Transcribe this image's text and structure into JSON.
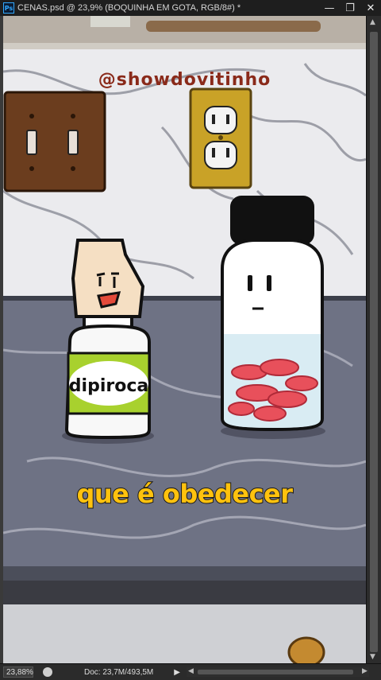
{
  "window": {
    "app_icon_label": "Ps",
    "title": "CENAS.psd @ 23,9% (BOQUINHA EM GOTA, RGB/8#) *",
    "minimize_glyph": "—",
    "restore_glyph": "❐",
    "close_glyph": "✕"
  },
  "canvas": {
    "watermark": "@showdovitinho",
    "subtitle": "que é obedecer",
    "bottle_label": "dipiroca"
  },
  "statusbar": {
    "zoom": "23,88%",
    "doc_info": "Doc: 23,7M/493,5M",
    "play_glyph": "▶"
  },
  "colors": {
    "subtitle_fill": "#ffc20e",
    "watermark": "#8a2a1a",
    "bottle_band": "#a8d12e",
    "gummies": "#e8505b"
  }
}
